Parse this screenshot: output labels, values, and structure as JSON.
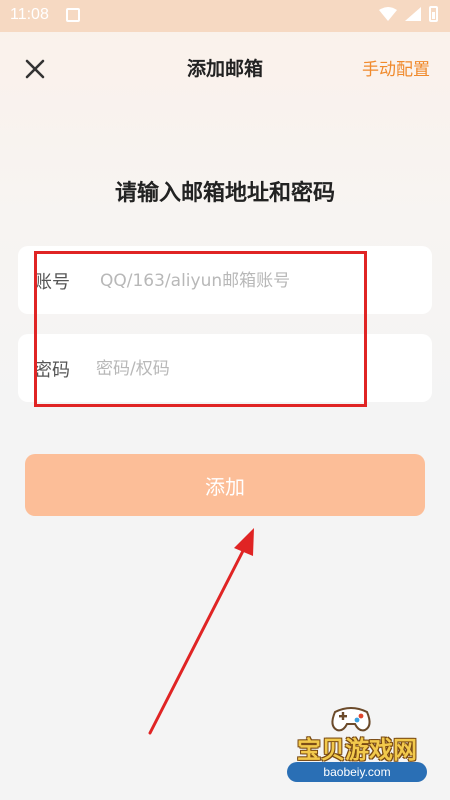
{
  "status_bar": {
    "time": "11:08",
    "icons": [
      "notification-icon",
      "wifi-icon",
      "signal-icon",
      "battery-icon"
    ]
  },
  "header": {
    "close_icon": "close-icon",
    "title": "添加邮箱",
    "manual_config_label": "手动配置"
  },
  "heading": "请输入邮箱地址和密码",
  "form": {
    "account": {
      "label": "账号",
      "value": "",
      "placeholder": "QQ/163/aliyun邮箱账号"
    },
    "password": {
      "label": "密码",
      "value": "",
      "placeholder": "密码/权码"
    }
  },
  "add_button_label": "添加",
  "watermark": {
    "title": "宝贝游戏网",
    "url": "baobeiy.com"
  },
  "colors": {
    "accent": "#f08a2c",
    "button": "#fcbe98",
    "annotation_red": "#e02424"
  }
}
